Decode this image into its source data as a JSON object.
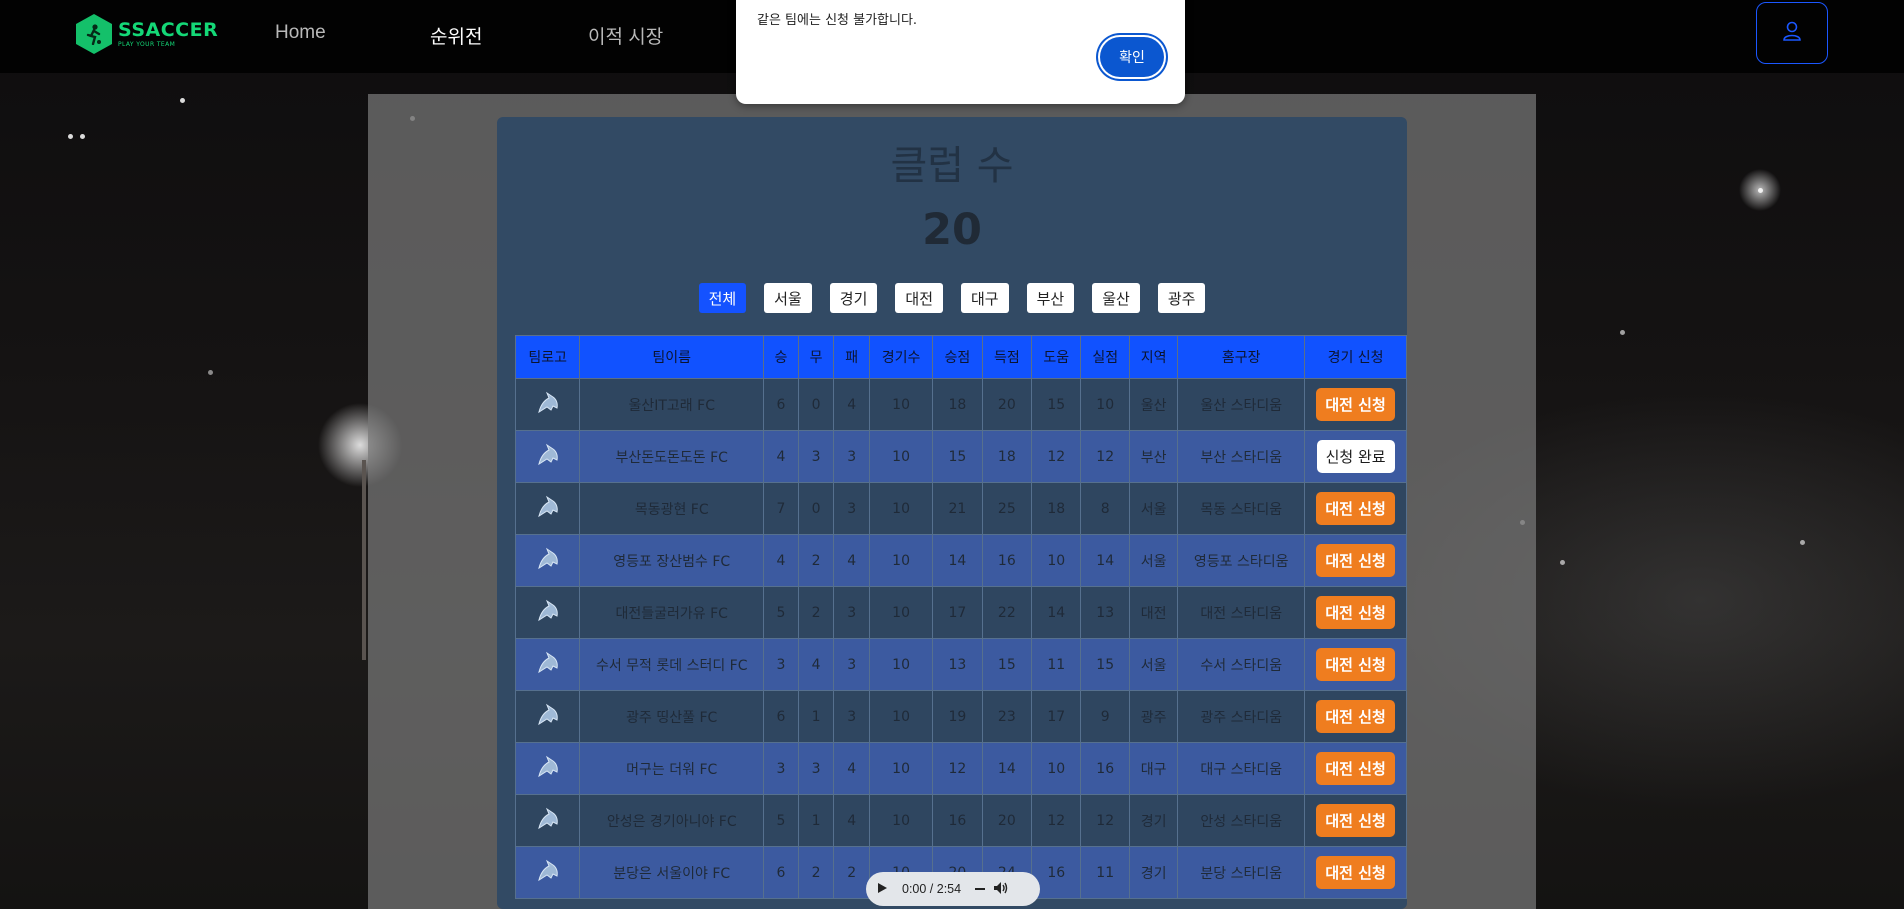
{
  "nav": {
    "logo_name": "SSACCER",
    "logo_tagline": "PLAY YOUR TEAM",
    "links": [
      {
        "label": "Home",
        "active": false
      },
      {
        "label": "순위전",
        "active": true
      },
      {
        "label": "이적 시장",
        "active": false
      }
    ],
    "user_icon": "user-icon"
  },
  "alert": {
    "message": "같은 팀에는 신청 불가합니다.",
    "ok_label": "확인"
  },
  "summary": {
    "title": "클럽 수",
    "count": "20"
  },
  "filters": [
    {
      "label": "전체",
      "active": true
    },
    {
      "label": "서울",
      "active": false
    },
    {
      "label": "경기",
      "active": false
    },
    {
      "label": "대전",
      "active": false
    },
    {
      "label": "대구",
      "active": false
    },
    {
      "label": "부산",
      "active": false
    },
    {
      "label": "울산",
      "active": false
    },
    {
      "label": "광주",
      "active": false
    }
  ],
  "table": {
    "headers": [
      "팀로고",
      "팀이름",
      "승",
      "무",
      "패",
      "경기수",
      "승점",
      "득점",
      "도움",
      "실점",
      "지역",
      "홈구장",
      "경기 신청"
    ],
    "rows": [
      {
        "name": "울산IT고래 FC",
        "w": "6",
        "d": "0",
        "l": "4",
        "games": "10",
        "pts": "18",
        "gf": "20",
        "ast": "15",
        "ga": "10",
        "region": "울산",
        "stadium": "울산 스타디움",
        "action": "대전 신청",
        "done": false
      },
      {
        "name": "부산돈도돈도돈 FC",
        "w": "4",
        "d": "3",
        "l": "3",
        "games": "10",
        "pts": "15",
        "gf": "18",
        "ast": "12",
        "ga": "12",
        "region": "부산",
        "stadium": "부산 스타디움",
        "action": "신청 완료",
        "done": true
      },
      {
        "name": "목동광현 FC",
        "w": "7",
        "d": "0",
        "l": "3",
        "games": "10",
        "pts": "21",
        "gf": "25",
        "ast": "18",
        "ga": "8",
        "region": "서울",
        "stadium": "목동 스타디움",
        "action": "대전 신청",
        "done": false
      },
      {
        "name": "영등포 장산범수 FC",
        "w": "4",
        "d": "2",
        "l": "4",
        "games": "10",
        "pts": "14",
        "gf": "16",
        "ast": "10",
        "ga": "14",
        "region": "서울",
        "stadium": "영등포 스타디움",
        "action": "대전 신청",
        "done": false
      },
      {
        "name": "대전들굴러가유 FC",
        "w": "5",
        "d": "2",
        "l": "3",
        "games": "10",
        "pts": "17",
        "gf": "22",
        "ast": "14",
        "ga": "13",
        "region": "대전",
        "stadium": "대전 스타디움",
        "action": "대전 신청",
        "done": false
      },
      {
        "name": "수서 무적 롯데 스터디 FC",
        "w": "3",
        "d": "4",
        "l": "3",
        "games": "10",
        "pts": "13",
        "gf": "15",
        "ast": "11",
        "ga": "15",
        "region": "서울",
        "stadium": "수서 스타디움",
        "action": "대전 신청",
        "done": false
      },
      {
        "name": "광주 띵산풀 FC",
        "w": "6",
        "d": "1",
        "l": "3",
        "games": "10",
        "pts": "19",
        "gf": "23",
        "ast": "17",
        "ga": "9",
        "region": "광주",
        "stadium": "광주 스타디움",
        "action": "대전 신청",
        "done": false
      },
      {
        "name": "머구는 더워 FC",
        "w": "3",
        "d": "3",
        "l": "4",
        "games": "10",
        "pts": "12",
        "gf": "14",
        "ast": "10",
        "ga": "16",
        "region": "대구",
        "stadium": "대구 스타디움",
        "action": "대전 신청",
        "done": false
      },
      {
        "name": "안성은 경기아니야 FC",
        "w": "5",
        "d": "1",
        "l": "4",
        "games": "10",
        "pts": "16",
        "gf": "20",
        "ast": "12",
        "ga": "12",
        "region": "경기",
        "stadium": "안성 스타디움",
        "action": "대전 신청",
        "done": false
      },
      {
        "name": "분당은 서울이야 FC",
        "w": "6",
        "d": "2",
        "l": "2",
        "games": "10",
        "pts": "20",
        "gf": "24",
        "ast": "16",
        "ga": "11",
        "region": "경기",
        "stadium": "분당 스타디움",
        "action": "대전 신청",
        "done": false
      }
    ]
  },
  "audio": {
    "time": "0:00 / 2:54",
    "play_icon": "play-icon",
    "menu_icon": "more-icon",
    "volume_icon": "volume-icon"
  },
  "colors": {
    "accent": "#1452ff",
    "apply": "#ef7d1f",
    "brand": "#14d877"
  }
}
